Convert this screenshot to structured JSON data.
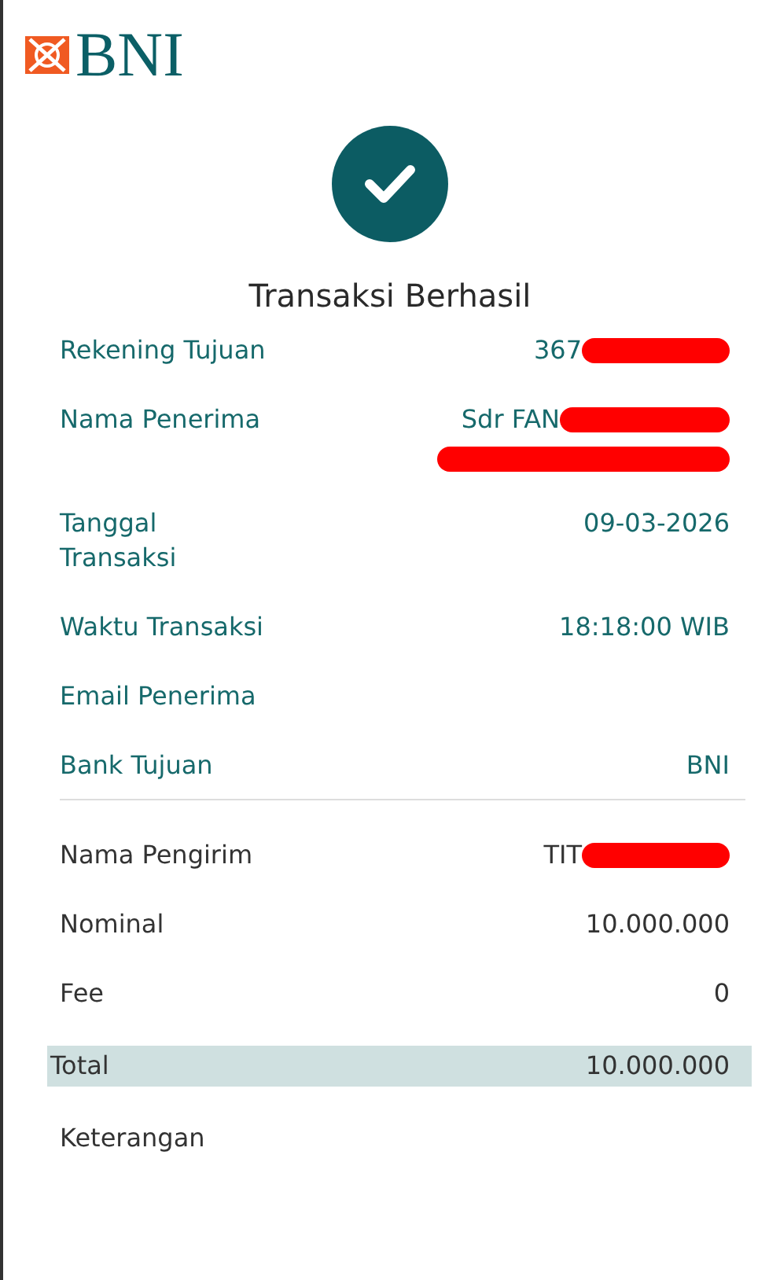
{
  "logo": {
    "text": "BNI"
  },
  "status": {
    "title": "Transaksi Berhasil"
  },
  "details": [
    {
      "label": "Rekening Tujuan",
      "value": "367",
      "redacted": true,
      "redacted_below": false
    },
    {
      "label": "Nama Penerima",
      "value": "Sdr FAN",
      "redacted": true,
      "redacted_below": true
    },
    {
      "label": "Tanggal Transaksi",
      "value": "09-03-2026",
      "redacted": false,
      "redacted_below": false
    },
    {
      "label": "Waktu Transaksi",
      "value": "18:18:00 WIB",
      "redacted": false,
      "redacted_below": false
    },
    {
      "label": "Email Penerima"
    },
    {
      "label": "Bank Tujuan",
      "value": "BNI",
      "redacted": false,
      "redacted_below": false
    }
  ],
  "summary": [
    {
      "label": "Nama Pengirim",
      "value": "TIT",
      "redacted": true,
      "redacted_below": false,
      "highlighted": false
    },
    {
      "label": "Nominal",
      "value": "10.000.000",
      "redacted": false,
      "redacted_below": false,
      "highlighted": false
    },
    {
      "label": "Fee",
      "value": "0",
      "redacted": false,
      "redacted_below": false,
      "highlighted": false
    },
    {
      "label": "Total",
      "value": "10.000.000",
      "redacted": false,
      "redacted_below": false,
      "highlighted": true
    },
    {
      "label": "Keterangan",
      "highlighted": false
    }
  ]
}
